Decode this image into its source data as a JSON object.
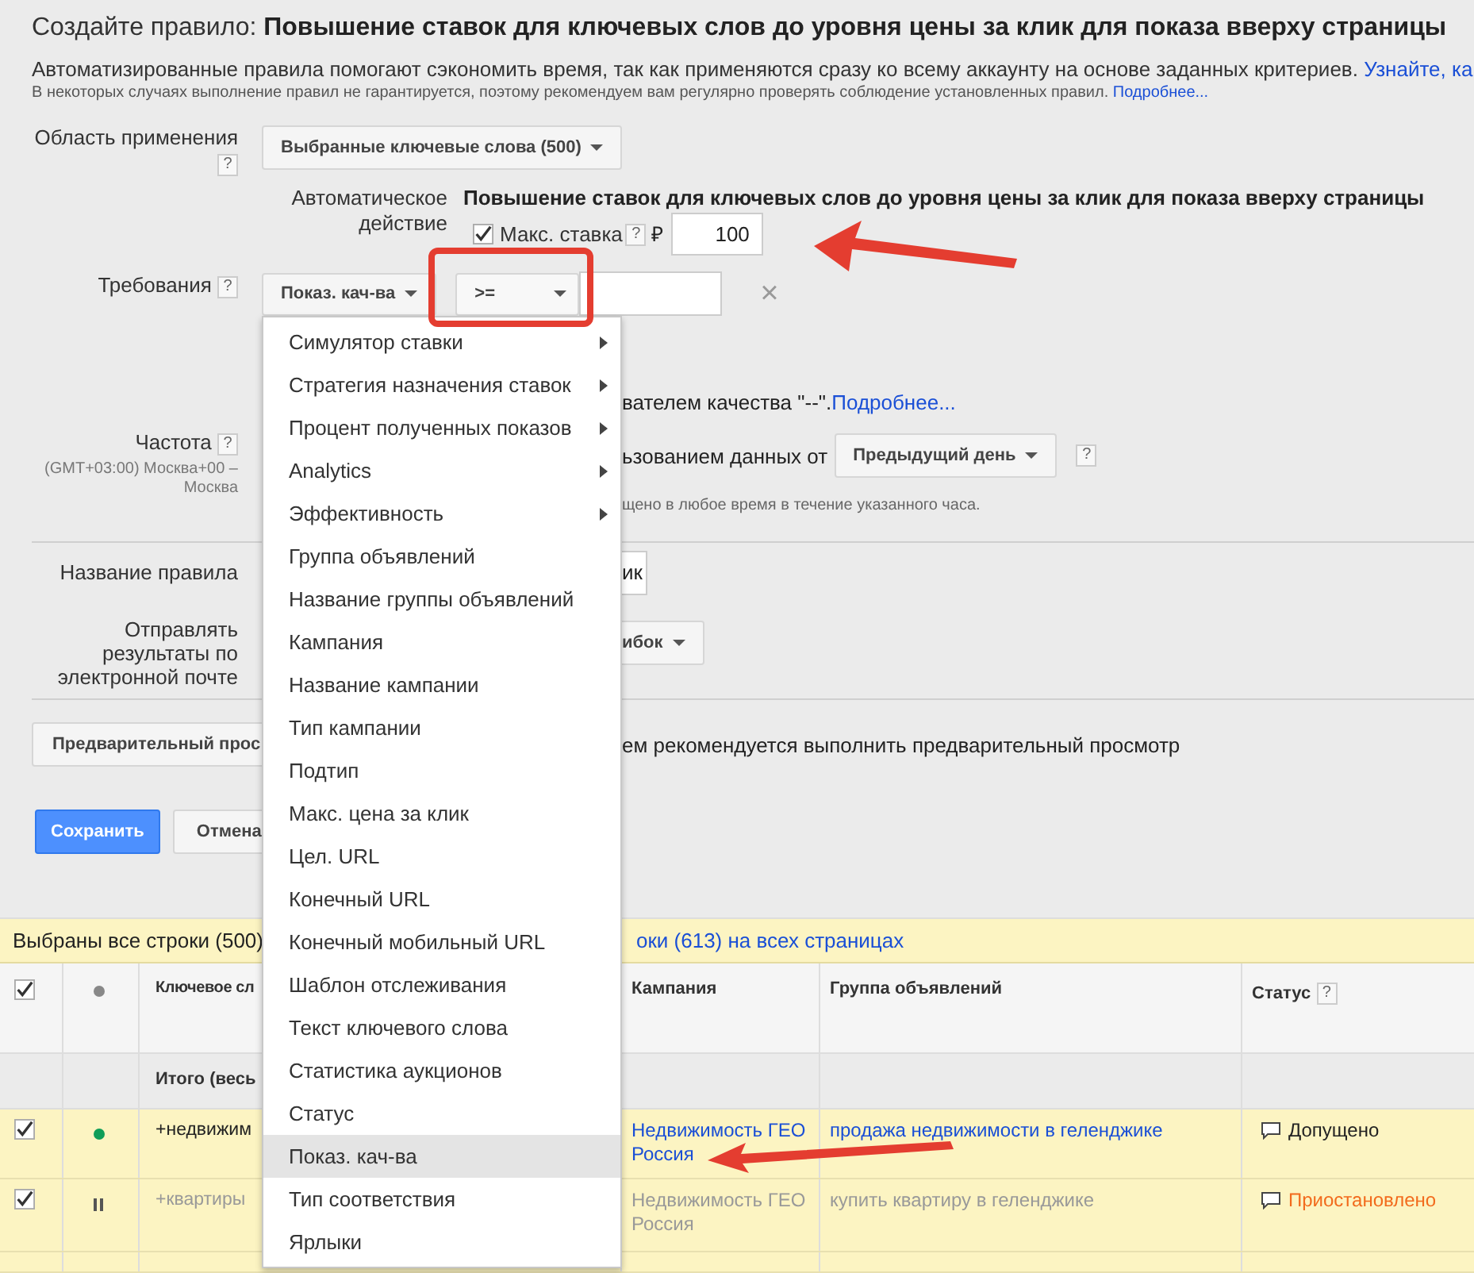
{
  "title": {
    "prefix": "Создайте правило:",
    "rule": "Повышение ставок для ключевых слов до уровня цены за клик для показа вверху страницы"
  },
  "description": {
    "text": "Автоматизированные правила помогают сэкономить время, так как применяются сразу ко всему аккаунту на основе заданных критериев.",
    "link": "Узнайте, ка"
  },
  "note": {
    "text": "В некоторых случаях выполнение правил не гарантируется, поэтому рекомендуем вам регулярно проверять соблюдение установленных правил.",
    "link": "Подробнее..."
  },
  "scope": {
    "label": "Область применения",
    "help": "?",
    "value": "Выбранные ключевые слова (500)"
  },
  "action": {
    "label": "Автоматическое действие",
    "value": "Повышение ставок для ключевых слов до уровня цены за клик для показа вверху страницы",
    "max_bid": {
      "checked": true,
      "label": "Макс. ставка",
      "help": "?",
      "currency": "₽",
      "value": "100"
    }
  },
  "requirements": {
    "label": "Требования",
    "help": "?",
    "metric": "Показ. кач-ва",
    "operator": ">=",
    "remove": "×",
    "note": "вателем качества \"--\".",
    "link": "Подробнее..."
  },
  "frequency": {
    "label": "Частота",
    "help": "?",
    "timezone": "(GMT+03:00) Москва+00 – Москва",
    "data_text": "ьзованием данных от",
    "period": "Предыдущий день",
    "period_help": "?",
    "hint": "щено в любое время в течение указанного часа."
  },
  "rule_name": {
    "label": "Название правила",
    "value": "ик"
  },
  "email": {
    "label": "Отправлять результаты по электронной почте",
    "value": "ибок"
  },
  "preview": {
    "button": "Предварительный прос",
    "text": "ем рекомендуется выполнить предварительный просмотр"
  },
  "buttons": [
    {
      "label": "Сохранить",
      "kind": "primary"
    },
    {
      "label": "Отмена",
      "kind": "secondary"
    }
  ],
  "selection_bar": {
    "text": "Выбраны все строки (500)",
    "link": "оки (613) на всех страницах"
  },
  "table": {
    "header_checked": true,
    "columns": [
      "Ключевое сл",
      "Кампания",
      "Группа объявлений",
      "Статус"
    ],
    "status_help": "?",
    "totals": "Итого (весь",
    "rows": [
      {
        "checked": true,
        "kind": "active",
        "keyword": "+недвижим",
        "campaign": "Недвижимость ГЕО Россия",
        "ad_group": "продажа недвижимости в геленджике",
        "status": "Допущено"
      },
      {
        "checked": true,
        "kind": "paused",
        "keyword": "+квартиры",
        "campaign": "Недвижимость ГЕО Россия",
        "ad_group": "купить квартиру в геленджике",
        "status": "Приостановлено"
      }
    ]
  },
  "dropdown_menu": {
    "items": [
      {
        "label": "Симулятор ставки",
        "submenu": true,
        "selected": false
      },
      {
        "label": "Стратегия назначения ставок",
        "submenu": true,
        "selected": false
      },
      {
        "label": "Процент полученных показов",
        "submenu": true,
        "selected": false
      },
      {
        "label": "Analytics",
        "submenu": true,
        "selected": false
      },
      {
        "label": "Эффективность",
        "submenu": true,
        "selected": false
      },
      {
        "label": "Группа объявлений",
        "submenu": false,
        "selected": false
      },
      {
        "label": "Название группы объявлений",
        "submenu": false,
        "selected": false
      },
      {
        "label": "Кампания",
        "submenu": false,
        "selected": false
      },
      {
        "label": "Название кампании",
        "submenu": false,
        "selected": false
      },
      {
        "label": "Тип кампании",
        "submenu": false,
        "selected": false
      },
      {
        "label": "Подтип",
        "submenu": false,
        "selected": false
      },
      {
        "label": "Макс. цена за клик",
        "submenu": false,
        "selected": false
      },
      {
        "label": "Цел. URL",
        "submenu": false,
        "selected": false
      },
      {
        "label": "Конечный URL",
        "submenu": false,
        "selected": false
      },
      {
        "label": "Конечный мобильный URL",
        "submenu": false,
        "selected": false
      },
      {
        "label": "Шаблон отслеживания",
        "submenu": false,
        "selected": false
      },
      {
        "label": "Текст ключевого слова",
        "submenu": false,
        "selected": false
      },
      {
        "label": "Статистика аукционов",
        "submenu": false,
        "selected": false
      },
      {
        "label": "Статус",
        "submenu": false,
        "selected": false
      },
      {
        "label": "Показ. кач-ва",
        "submenu": false,
        "selected": true
      },
      {
        "label": "Тип соответствия",
        "submenu": false,
        "selected": false
      },
      {
        "label": "Ярлыки",
        "submenu": false,
        "selected": false
      }
    ]
  }
}
